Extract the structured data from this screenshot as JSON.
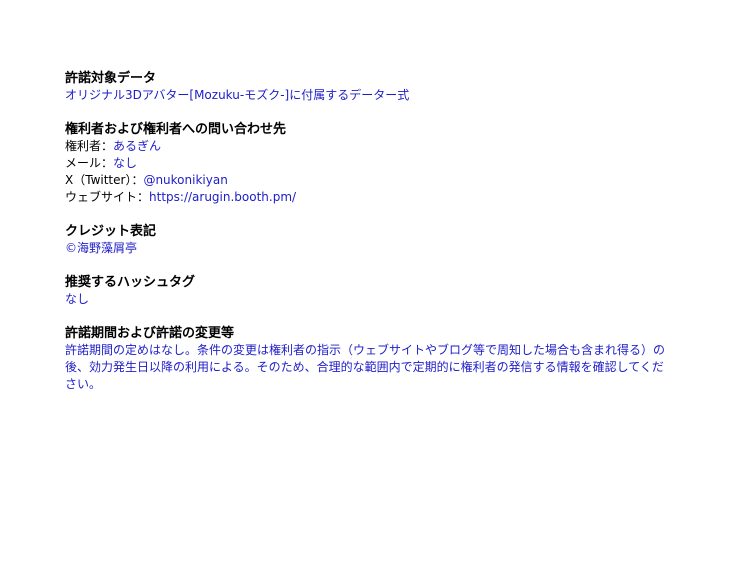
{
  "sections": {
    "target": {
      "heading": "許諾対象データ",
      "value": "オリジナル3Dアバター[Mozuku-モズク-]に付属するデーター式"
    },
    "contact": {
      "heading": "権利者および権利者への問い合わせ先",
      "rights_holder_label": "権利者：",
      "rights_holder_value": "あるぎん",
      "mail_label": "メール：",
      "mail_value": "なし",
      "twitter_label": "X（Twitter）：",
      "twitter_value": "@nukonikiyan",
      "website_label": "ウェブサイト：",
      "website_value": "https://arugin.booth.pm/"
    },
    "credit": {
      "heading": "クレジット表記",
      "value": "©海野藻屑亭"
    },
    "hashtag": {
      "heading": "推奨するハッシュタグ",
      "value": "なし"
    },
    "terms": {
      "heading": "許諾期間および許諾の変更等",
      "value": "許諾期間の定めはなし。条件の変更は権利者の指示（ウェブサイトやブログ等で周知した場合も含まれ得る）の後、効力発生日以降の利用による。そのため、合理的な範囲内で定期的に権利者の発信する情報を確認してください。"
    }
  },
  "colors": {
    "text": "#000000",
    "value": "#1d1dc8",
    "background": "#ffffff"
  }
}
